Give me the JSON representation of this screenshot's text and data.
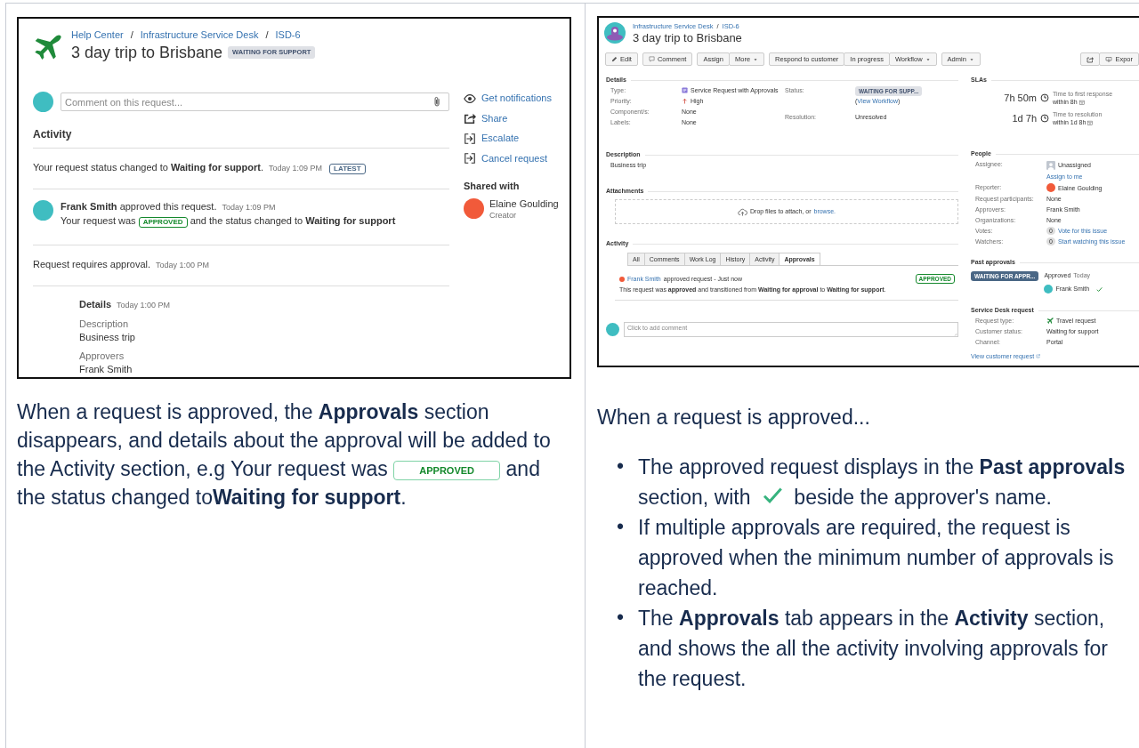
{
  "left_panel": {
    "screenshot": {
      "breadcrumbs": [
        {
          "label": "Help Center"
        },
        {
          "label": "Infrastructure Service Desk"
        },
        {
          "label": "ISD-6"
        }
      ],
      "separators": [
        "/",
        "/"
      ],
      "title": "3 day trip to Brisbane",
      "status": "WAITING FOR SUPPORT",
      "comment_field": {
        "placeholder": "Comment on this request..."
      },
      "activity": {
        "heading": "Activity",
        "entries": [
          {
            "kind": "event",
            "text": "Your request status changed to **Waiting for support**.",
            "time": "Today 1:09 PM",
            "badge": "LATEST"
          },
          {
            "kind": "approval",
            "text": "**Frank Smith** approved this request.",
            "time": "Today 1:09 PM",
            "detail_before": "Your request was",
            "badge": "APPROVED",
            "detail_after": "and the status changed to **Waiting for support**"
          },
          {
            "kind": "event",
            "text": "Request requires approval.",
            "time": "Today 1:00 PM"
          },
          {
            "kind": "details",
            "heading": "Details",
            "time": "Today 1:00 PM",
            "fields": [
              {
                "label": "Description",
                "value": "Business trip"
              },
              {
                "label": "Approvers",
                "value": "Frank Smith"
              }
            ]
          }
        ]
      },
      "actions": [
        {
          "kind": "notify",
          "label": "Get notifications"
        },
        {
          "kind": "share",
          "label": "Share"
        },
        {
          "kind": "escalate",
          "label": "Escalate"
        },
        {
          "kind": "escalate",
          "label": "Cancel request"
        }
      ],
      "shared_with": {
        "heading": "Shared with",
        "name": "Elaine Goulding",
        "role": "Creator"
      }
    },
    "caption": {
      "before": "When a request is approved, the **Approvals** section disappears, and details about the approval will be added to the Activity section, e.g Your request was",
      "badge": "APPROVED",
      "after": "and the status changed to**Waiting for support**."
    }
  },
  "right_panel": {
    "screenshot": {
      "breadcrumbs": [
        {
          "label": "Infrastructure Service Desk"
        },
        {
          "label": "ISD-6"
        }
      ],
      "separators": [
        "/"
      ],
      "title": "3 day trip to Brisbane",
      "toolbar": [
        {
          "buttons": [
            {
              "label": "Edit",
              "kind": "pencil",
              "dropdown": false
            }
          ]
        },
        {
          "buttons": [
            {
              "label": "Comment",
              "kind": "comment",
              "dropdown": false
            }
          ]
        },
        {
          "buttons": [
            {
              "label": "Assign",
              "kind": "plain",
              "dropdown": false
            },
            {
              "label": "More",
              "kind": "plain",
              "dropdown": true
            }
          ]
        },
        {
          "buttons": [
            {
              "label": "Respond to customer",
              "kind": "plain",
              "dropdown": false
            },
            {
              "label": "In progress",
              "kind": "plain",
              "dropdown": false
            },
            {
              "label": "Workflow",
              "kind": "plain",
              "dropdown": true
            }
          ]
        },
        {
          "buttons": [
            {
              "label": "Admin",
              "kind": "plain",
              "dropdown": true
            }
          ]
        }
      ],
      "toolbar_right": [
        {
          "kind": "share"
        },
        {
          "kind": "export",
          "label": "Expor"
        }
      ],
      "details": {
        "heading": "Details",
        "fields": [
          {
            "label": "Type:",
            "value": "Service Request with Approvals",
            "kind": "request-type"
          },
          {
            "label": "Priority:",
            "value": "High",
            "kind": "priority"
          },
          {
            "label": "Component/s:",
            "value": "None",
            "kind": "plain"
          },
          {
            "label": "Labels:",
            "value": "None",
            "kind": "plain"
          }
        ],
        "status_fields": [
          {
            "label": "Status:",
            "kind": "lozenge",
            "value": "WAITING FOR SUPP...",
            "link_open": "(",
            "link": "View Workflow",
            "link_close": ")"
          },
          {
            "label": "Resolution:",
            "kind": "text",
            "value": "Unresolved"
          }
        ]
      },
      "description": {
        "heading": "Description",
        "text": "Business trip"
      },
      "attachments": {
        "heading": "Attachments",
        "drop_text": "Drop files to attach, or",
        "link": "browse."
      },
      "activity": {
        "heading": "Activity",
        "tabs": [
          {
            "label": "All",
            "selected": false
          },
          {
            "label": "Comments",
            "selected": false
          },
          {
            "label": "Work Log",
            "selected": false
          },
          {
            "label": "History",
            "selected": false
          },
          {
            "label": "Activity",
            "selected": false
          },
          {
            "label": "Approvals",
            "selected": true
          }
        ],
        "entries": [
          {
            "author": "Frank Smith",
            "action": "approved request - Just now",
            "badge": "APPROVED",
            "text": "This request was **approved** and transitioned from **Waiting for approval** to **Waiting for support**."
          }
        ]
      },
      "comment_field": {
        "placeholder": "Click to add comment"
      },
      "slas": {
        "heading": "SLAs",
        "items": [
          {
            "remaining": "7h 50m",
            "name": "Time to first response",
            "target": "within 8h"
          },
          {
            "remaining": "1d 7h",
            "name": "Time to resolution",
            "target": "within 1d 8h"
          }
        ]
      },
      "people": {
        "heading": "People",
        "rows": [
          {
            "label": "Assignee:",
            "kind": "unassigned",
            "value": "Unassigned",
            "link": "Assign to me"
          },
          {
            "label": "Reporter:",
            "kind": "user",
            "value": "Elaine Goulding"
          },
          {
            "label": "Request participants:",
            "kind": "text",
            "value": "None"
          },
          {
            "label": "Approvers:",
            "kind": "text",
            "value": "Frank Smith"
          },
          {
            "label": "Organizations:",
            "kind": "text",
            "value": "None"
          },
          {
            "label": "Votes:",
            "kind": "count",
            "count": "0",
            "value": "Vote for this issue"
          },
          {
            "label": "Watchers:",
            "kind": "count",
            "count": "0",
            "value": "Start watching this issue"
          }
        ]
      },
      "past_approvals": {
        "heading": "Past approvals",
        "status": "WAITING FOR APPR...",
        "result": "Approved",
        "time": "Today",
        "approver": "Frank Smith"
      },
      "service_desk_request": {
        "heading": "Service Desk request",
        "rows": [
          {
            "label": "Request type:",
            "value": "Travel request",
            "kind": "plane"
          },
          {
            "label": "Customer status:",
            "value": "Waiting for support",
            "kind": "plain"
          },
          {
            "label": "Channel:",
            "value": "Portal",
            "kind": "plain"
          }
        ],
        "link": "View customer request"
      }
    },
    "caption": {
      "intro": "When a request is approved...",
      "bullets": [
        {
          "kind": "icon",
          "marker": "•",
          "before": "The approved request displays in the **Past approvals** section, with",
          "after": "beside the approver's name."
        },
        {
          "kind": "text",
          "marker": "•",
          "text": "If multiple approvals are required, the request is approved when the minimum number of approvals is reached."
        },
        {
          "kind": "text",
          "marker": "•",
          "text": "The **Approvals** tab appears in the **Activity** section, and shows the all the activity involving approvals for the request."
        }
      ]
    }
  }
}
